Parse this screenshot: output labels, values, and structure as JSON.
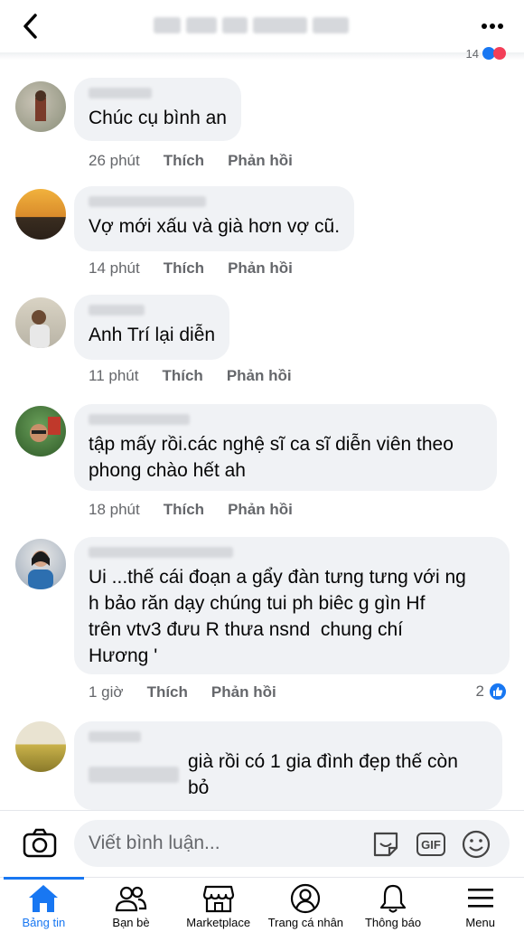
{
  "header": {
    "back_icon": "chevron-left-icon",
    "more_icon": "more-dots-icon",
    "top_reaction_count": "14"
  },
  "comments": [
    {
      "text": "Chúc cụ bình an",
      "time": "26 phút",
      "like": "Thích",
      "reply": "Phản hồi",
      "avatar_color": "#8a8f7a"
    },
    {
      "text": "Vợ mới xấu và già hơn vợ cũ.",
      "time": "14 phút",
      "like": "Thích",
      "reply": "Phản hồi",
      "avatar_color": "#d98b2b"
    },
    {
      "text": "Anh Trí lại diễn",
      "time": "11 phút",
      "like": "Thích",
      "reply": "Phản hồi",
      "avatar_color": "#b9b4a6"
    },
    {
      "text": "tập mấy rồi.các nghệ sĩ ca sĩ diễn viên theo\nphong chào hết ah",
      "time": "18 phút",
      "like": "Thích",
      "reply": "Phản hồi",
      "avatar_color": "#4a7a3a"
    },
    {
      "text": "Ui ...thế cái đoạn a gẩy đàn tưng tưng với ng\nh bảo răn dạy chúng tui ph biêc g gìn Hf\ntrên vtv3 đưu R thưa nsnd  chung chí\nHương '",
      "time": "1 giờ",
      "like": "Thích",
      "reply": "Phản hồi",
      "reactions": "2",
      "avatar_color": "#2d6fb0"
    },
    {
      "text": "già rồi có 1 gia đình đẹp thế còn\nbỏ",
      "avatar_color": "#c9b24a"
    }
  ],
  "input": {
    "placeholder": "Viết bình luận...",
    "gif_label": "GIF"
  },
  "nav": {
    "items": [
      {
        "label": "Bảng tin",
        "icon": "home-icon"
      },
      {
        "label": "Bạn bè",
        "icon": "friends-icon"
      },
      {
        "label": "Marketplace",
        "icon": "marketplace-icon"
      },
      {
        "label": "Trang cá nhân",
        "icon": "profile-icon"
      },
      {
        "label": "Thông báo",
        "icon": "bell-icon"
      },
      {
        "label": "Menu",
        "icon": "menu-icon"
      }
    ],
    "active_color": "#1877f2"
  }
}
